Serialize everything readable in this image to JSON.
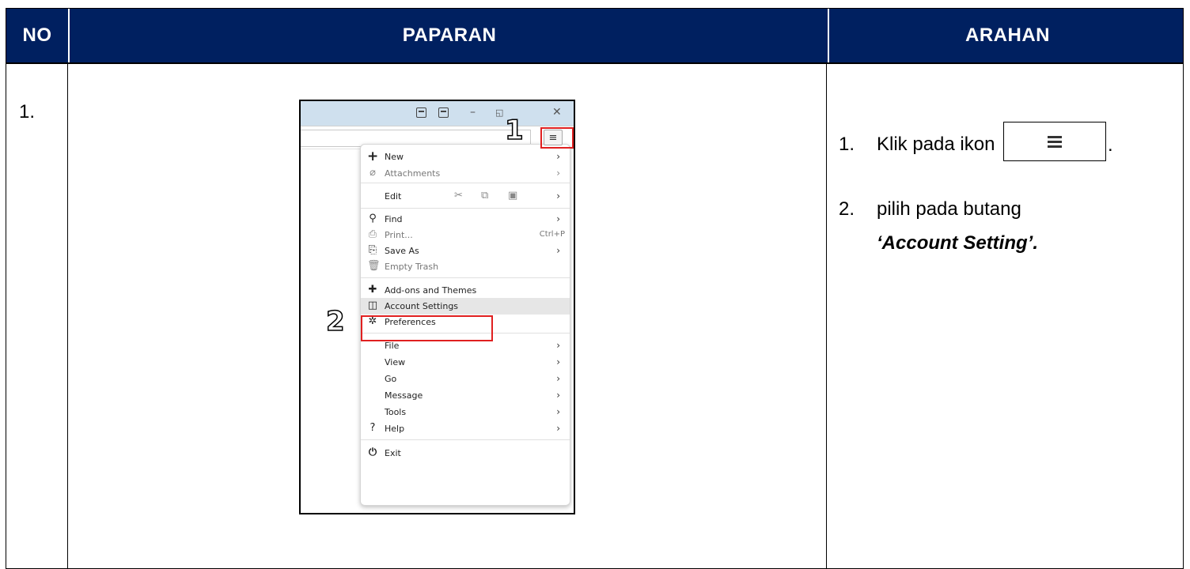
{
  "table": {
    "headers": {
      "no": "NO",
      "paparan": "PAPARAN",
      "arahan": "ARAHAN"
    },
    "row_number": "1."
  },
  "screenshot": {
    "step1_label": "1",
    "step2_label": "2",
    "hamburger_glyph": "≡",
    "window_controls": {
      "minimize": "–",
      "restore": "◱",
      "close": "✕"
    },
    "menu": {
      "new": "New",
      "attachments": "Attachments",
      "edit": "Edit",
      "find": "Find",
      "print": "Print...",
      "print_shortcut": "Ctrl+P",
      "save_as": "Save As",
      "empty_trash": "Empty Trash",
      "addons": "Add-ons and Themes",
      "account_settings": "Account Settings",
      "preferences": "Preferences",
      "file": "File",
      "view": "View",
      "go": "Go",
      "message": "Message",
      "tools": "Tools",
      "help": "Help",
      "exit": "Exit"
    },
    "colors": {
      "highlight_red": "#e02020",
      "titlebar": "#cfe0ee"
    }
  },
  "instructions": {
    "step1_num": "1.",
    "step1_text": "Klik pada ikon",
    "step1_period": ".",
    "step2_num": "2.",
    "step2_text": "pilih pada butang",
    "step2_emphasis": "‘Account Setting’."
  },
  "colors": {
    "header_bg": "#002060",
    "header_text": "#ffffff"
  }
}
